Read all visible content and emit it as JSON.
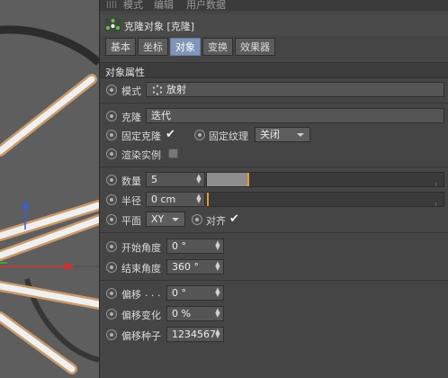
{
  "menubar": {
    "items": [
      "模式",
      "编辑",
      "用户数据"
    ]
  },
  "header": {
    "title": "克隆对象 [克隆]"
  },
  "tabs": [
    {
      "label": "基本",
      "active": false
    },
    {
      "label": "坐标",
      "active": false
    },
    {
      "label": "对象",
      "active": true
    },
    {
      "label": "变换",
      "active": false
    },
    {
      "label": "效果器",
      "active": false
    }
  ],
  "section": {
    "title": "对象属性"
  },
  "mode": {
    "label": "模式",
    "value": "放射"
  },
  "clone": {
    "label": "克隆",
    "value": "迭代",
    "fixed_clone_label": "固定克隆",
    "fixed_clone_checked": true,
    "fixed_texture_label": "固定纹理",
    "fixed_texture_value": "关闭",
    "render_instances_label": "渲染实例",
    "render_instances_checked": false
  },
  "count": {
    "label": "数量",
    "value": "5",
    "fraction": 0.17
  },
  "radius": {
    "label": "半径",
    "value": "0 cm",
    "fraction": 0.0
  },
  "plane": {
    "label": "平面",
    "value": "XY",
    "align_label": "对齐",
    "align_checked": true
  },
  "start_angle": {
    "label": "开始角度",
    "value": "0 °"
  },
  "end_angle": {
    "label": "结束角度",
    "value": "360 °"
  },
  "offset": {
    "label": "偏移",
    "dots": ". . .",
    "value": "0 °"
  },
  "offset_variation": {
    "label": "偏移变化",
    "value": "0 %"
  },
  "offset_seed": {
    "label": "偏移种子",
    "value": "1234567"
  },
  "icons": {
    "check": "✔"
  },
  "colors": {
    "active_tab": "#7f96b8",
    "slider_handle": "#e0a030",
    "panel_bg": "#454545"
  }
}
